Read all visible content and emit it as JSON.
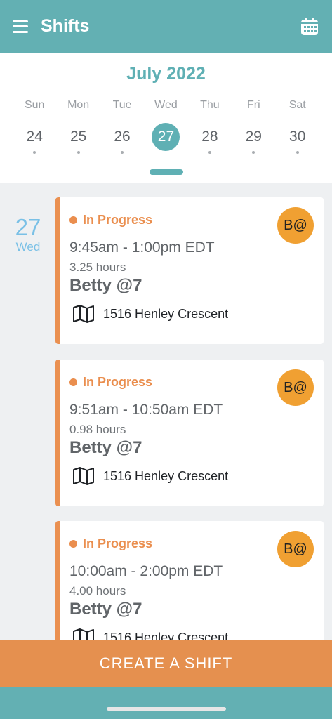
{
  "header": {
    "title": "Shifts",
    "menu_icon": "menu-icon",
    "calendar_icon": "calendar-icon",
    "color": "#63b0b3"
  },
  "calendar": {
    "month": "July 2022",
    "days": [
      {
        "name": "Sun",
        "num": "24",
        "selected": false
      },
      {
        "name": "Mon",
        "num": "25",
        "selected": false
      },
      {
        "name": "Tue",
        "num": "26",
        "selected": false
      },
      {
        "name": "Wed",
        "num": "27",
        "selected": true
      },
      {
        "name": "Thu",
        "num": "28",
        "selected": false
      },
      {
        "name": "Fri",
        "num": "29",
        "selected": false
      },
      {
        "name": "Sat",
        "num": "30",
        "selected": false
      }
    ]
  },
  "shift_list": {
    "date": {
      "num": "27",
      "day": "Wed"
    },
    "shifts": [
      {
        "status": "In Progress",
        "time": "9:45am - 1:00pm EDT",
        "hours": "3.25 hours",
        "client": "Betty @7",
        "address": "1516 Henley Crescent",
        "avatar": "B@"
      },
      {
        "status": "In Progress",
        "time": "9:51am - 10:50am EDT",
        "hours": "0.98 hours",
        "client": "Betty @7",
        "address": "1516 Henley Crescent",
        "avatar": "B@"
      },
      {
        "status": "In Progress",
        "time": "10:00am - 2:00pm EDT",
        "hours": "4.00 hours",
        "client": "Betty @7",
        "address": "1516 Henley Crescent",
        "avatar": "B@"
      }
    ]
  },
  "create_button": {
    "label": "CREATE A SHIFT",
    "color": "#e5904f"
  },
  "colors": {
    "accent": "#5fb0b4",
    "status": "#ea8e4e",
    "avatar": "#f0a032"
  }
}
